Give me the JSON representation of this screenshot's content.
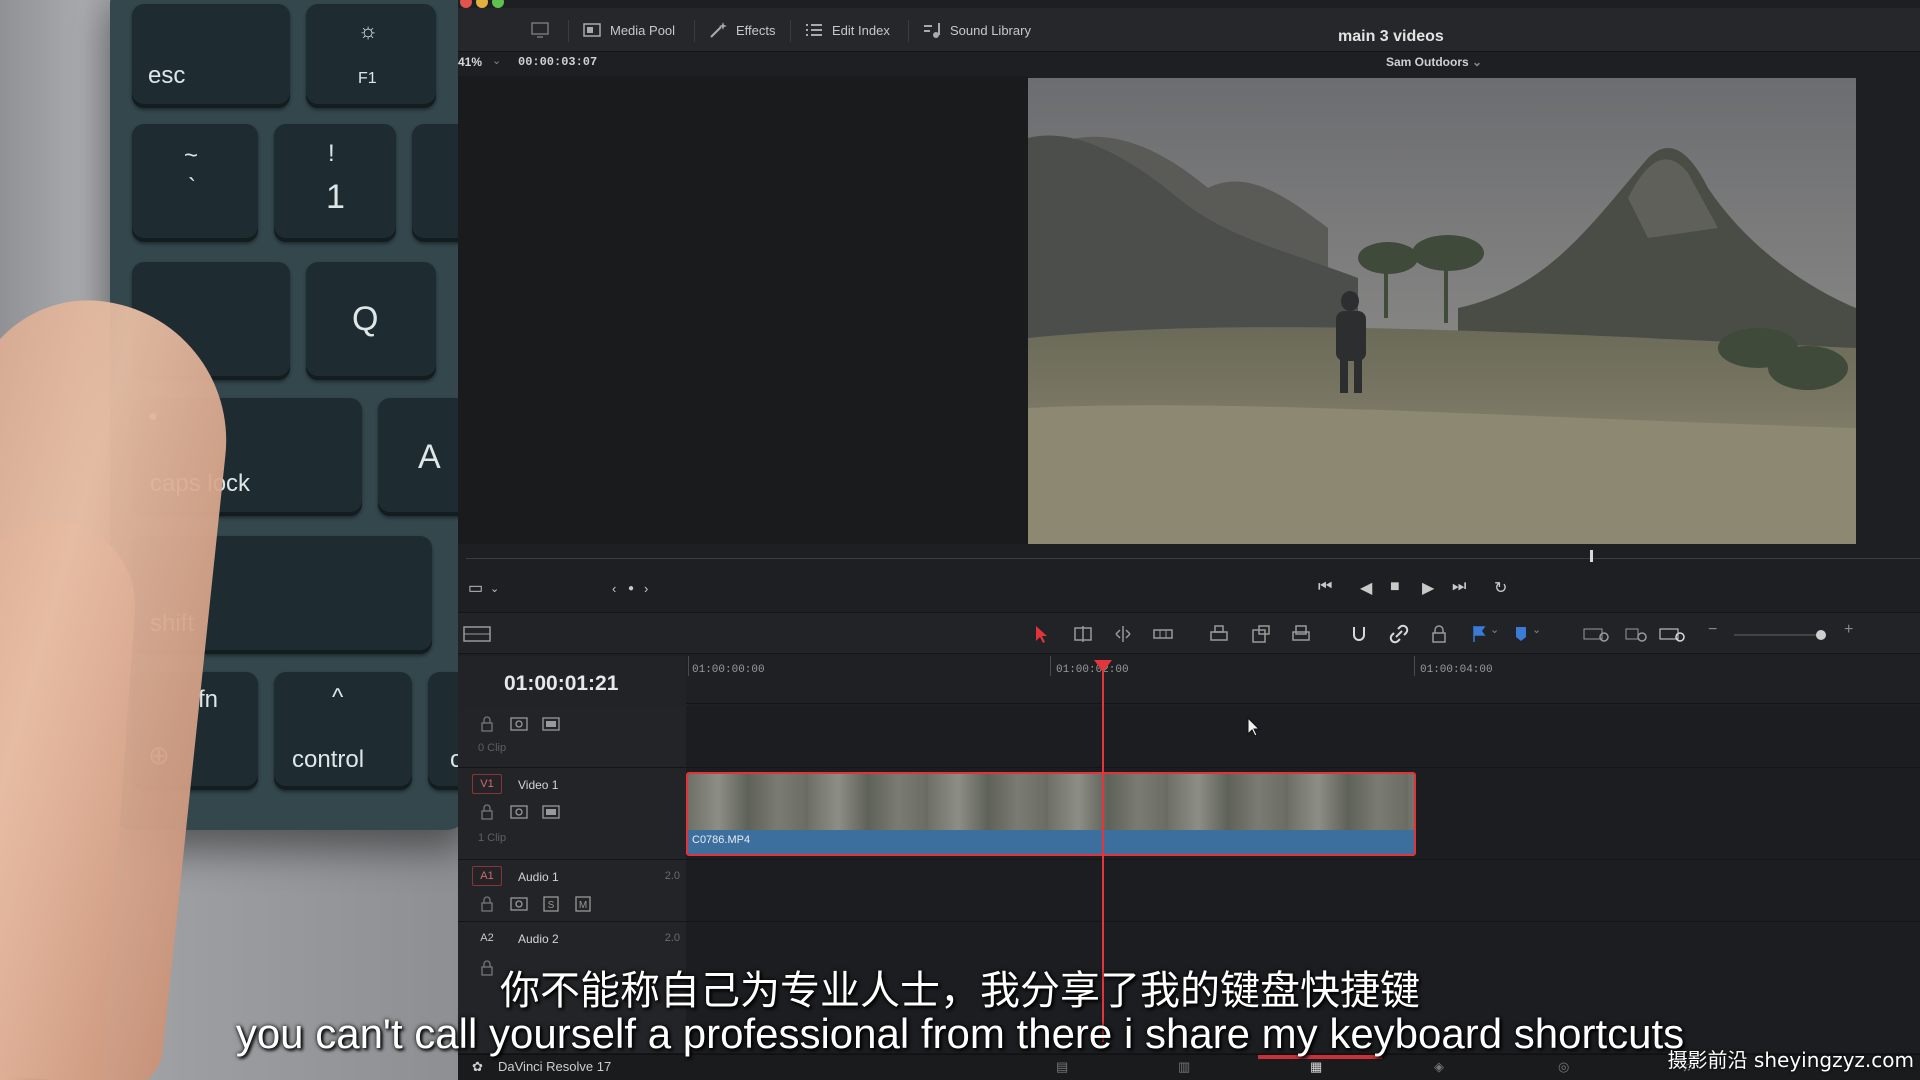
{
  "keyboard": {
    "keys": [
      {
        "id": "esc",
        "label": "esc"
      },
      {
        "id": "f1",
        "label": "F1"
      },
      {
        "id": "tilde",
        "top": "~",
        "bottom": "`"
      },
      {
        "id": "one",
        "top": "!",
        "bottom": "1"
      },
      {
        "id": "q",
        "label": "Q"
      },
      {
        "id": "capslock",
        "label": "caps lock"
      },
      {
        "id": "a",
        "label": "A"
      },
      {
        "id": "shift",
        "label": "shift"
      },
      {
        "id": "fn",
        "label": "fn"
      },
      {
        "id": "control",
        "label": "control"
      },
      {
        "id": "option",
        "label": "o"
      }
    ]
  },
  "topbar": {
    "media_pool": "Media Pool",
    "effects": "Effects",
    "edit_index": "Edit Index",
    "sound_library": "Sound Library",
    "title": "main 3 videos"
  },
  "viewer": {
    "zoom": "41%",
    "source_timecode": "00:00:03:07",
    "clip_name": "Sam Outdoors"
  },
  "timeline": {
    "timecode": "01:00:01:21",
    "ruler": [
      "01:00:00:00",
      "01:00:02:00",
      "01:00:04:00"
    ],
    "tracks": [
      {
        "tag": "",
        "name": "",
        "count": "0 Clip",
        "num": ""
      },
      {
        "tag": "V1",
        "name": "Video 1",
        "count": "1 Clip",
        "num": ""
      },
      {
        "tag": "A1",
        "name": "Audio 1",
        "count": "",
        "num": "2.0"
      },
      {
        "tag": "A2",
        "name": "Audio 2",
        "count": "",
        "num": "2.0"
      }
    ],
    "clip": {
      "name": "C0786.MP4"
    }
  },
  "bottombar": {
    "app_name": "DaVinci Resolve 17"
  },
  "subtitles": {
    "zh": "你不能称自己为专业人士，我分享了我的键盘快捷键",
    "en": "you can't call yourself a professional from there i share my keyboard shortcuts"
  },
  "watermark": "摄影前沿 sheyingzyz.com",
  "colors": {
    "accent_red": "#e3353b",
    "clip_blue": "#3c6f9e",
    "panel": "#1e1f22"
  }
}
